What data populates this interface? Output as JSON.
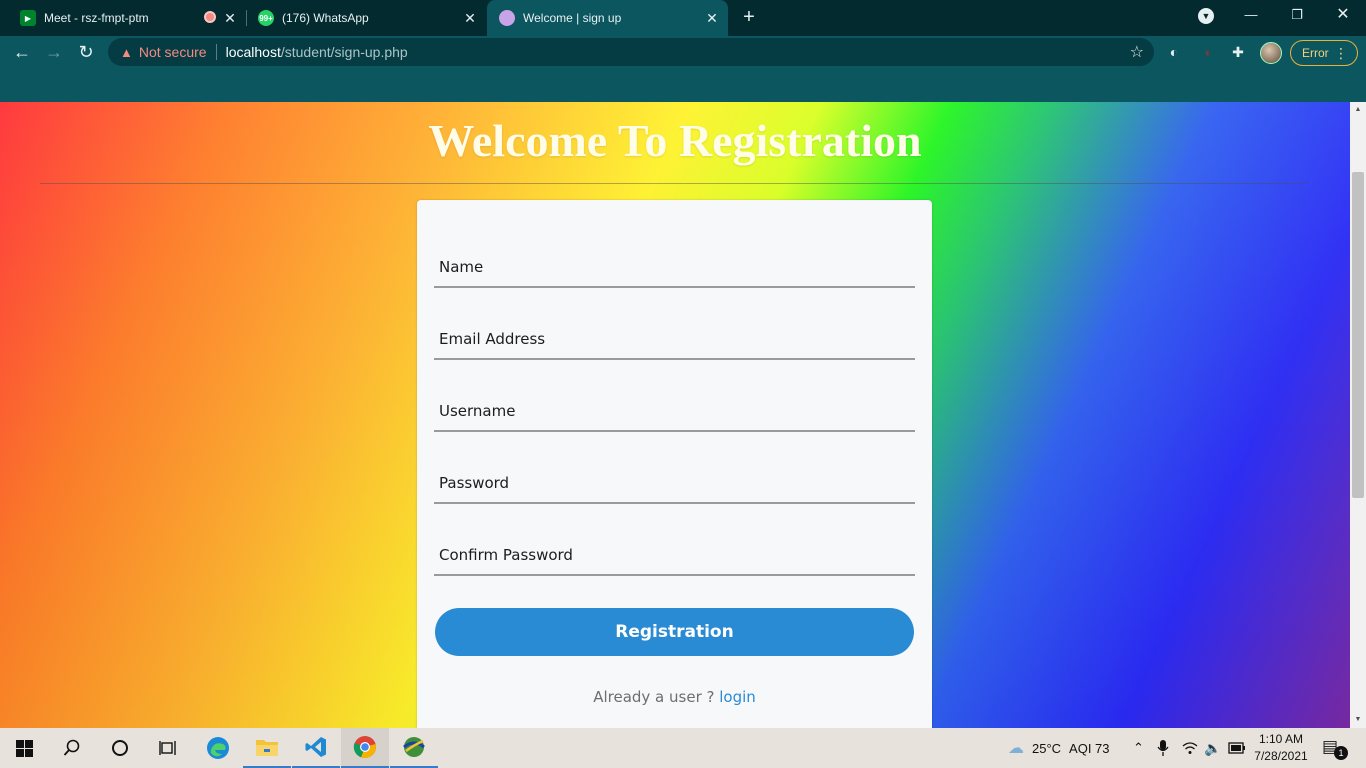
{
  "browser": {
    "tabs": [
      {
        "title": "Meet - rsz-fmpt-ptm",
        "favicon": "google-meet-icon",
        "recording": true,
        "active": false
      },
      {
        "title": "(176) WhatsApp",
        "favicon": "whatsapp-icon",
        "badge": "99+",
        "active": false
      },
      {
        "title": "Welcome | sign up",
        "favicon": "page-icon",
        "active": true
      }
    ],
    "new_tab_symbol": "+",
    "security_label": "Not secure",
    "url_host": "localhost",
    "url_path": "/student/sign-up.php",
    "error_label": "Error",
    "colors": {
      "chrome_dark": "#032a2f",
      "chrome": "#0c5660",
      "warning": "#f28b82"
    }
  },
  "page": {
    "title": "Welcome To Registration",
    "form": {
      "name_placeholder": "Name",
      "email_placeholder": "Email Address",
      "username_placeholder": "Username",
      "password_placeholder": "Password",
      "confirm_password_placeholder": "Confirm Password",
      "submit_label": "Registration",
      "already_text": "Already a user ? ",
      "login_link": "login"
    },
    "colors": {
      "button": "#2a8bd5",
      "card": "#f7f8fa",
      "title": "#fffde8"
    }
  },
  "taskbar": {
    "apps": [
      "start-icon",
      "search-icon",
      "cortana-icon",
      "task-view-icon",
      "edge-icon",
      "file-explorer-icon",
      "vscode-icon",
      "chrome-icon",
      "globe-app-icon"
    ],
    "weather": "25°C",
    "aqi": "AQI 73",
    "time": "1:10 AM",
    "date": "7/28/2021",
    "notification_count": "1"
  }
}
